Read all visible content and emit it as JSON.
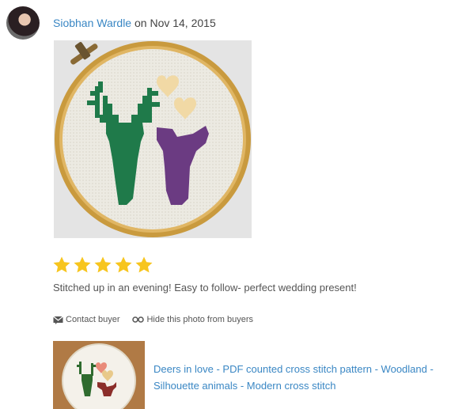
{
  "review": {
    "reviewer_name": "Siobhan Wardle",
    "date_prefix": "on",
    "date": "Nov 14, 2015",
    "rating": 5,
    "rating_max": 5,
    "text": "Stitched up in an evening! Easy to follow- perfect wedding present!"
  },
  "actions": {
    "contact_label": "Contact buyer",
    "hide_photo_label": "Hide this photo from buyers"
  },
  "listing": {
    "title": "Deers in love - PDF counted cross stitch pattern - Woodland - Silhouette animals - Modern cross stitch"
  },
  "colors": {
    "link": "#3a87c4",
    "star": "#f7c51e",
    "stag": "#1f7a4a",
    "doe": "#6b3b82",
    "heart": "#f1d9a5",
    "hoop": "#d6a94e"
  },
  "icons": {
    "contact": "envelope-icon",
    "hide": "eye-slash-icon"
  }
}
